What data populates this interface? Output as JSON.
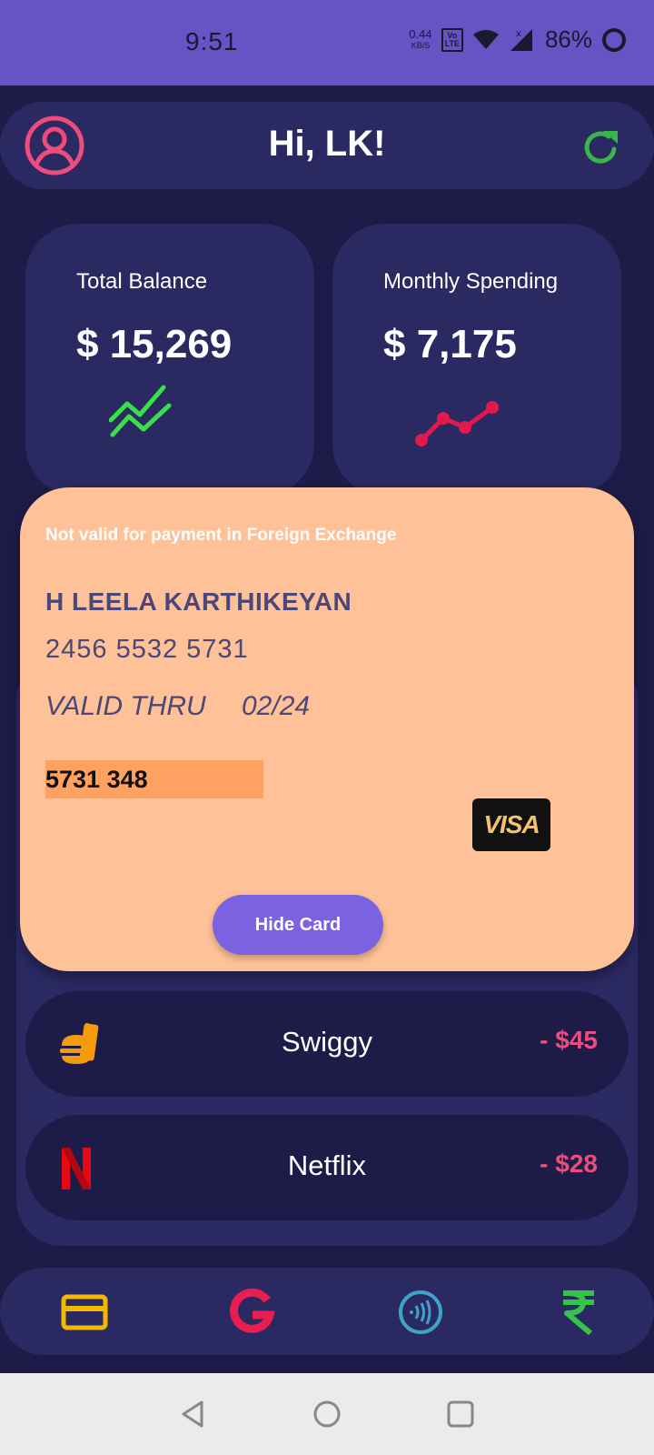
{
  "status_bar": {
    "time": "9:51",
    "net_speed_value": "0.44",
    "net_speed_unit": "KB/S",
    "volte_line1": "Vo",
    "volte_line2": "LTE",
    "battery_percent": "86%"
  },
  "header": {
    "greeting": "Hi, LK!",
    "avatar_icon": "user-circle-icon",
    "refresh_icon": "refresh-icon"
  },
  "stats": {
    "total_balance": {
      "label": "Total Balance",
      "value": "$ 15,269",
      "trend_icon": "trend-zigzag-icon",
      "color": "#39e04a"
    },
    "monthly_spending": {
      "label": "Monthly Spending",
      "value": "$ 7,175",
      "trend_icon": "trend-line-icon",
      "color": "#e0194f"
    }
  },
  "card": {
    "notice": "Not valid for payment in Foreign Exchange",
    "holder": "H LEELA KARTHIKEYAN",
    "number": "2456 5532 5731",
    "valid_label": "VALID THRU",
    "valid_date": "02/24",
    "cvv_strip": "5731 348",
    "network": "VISA",
    "hide_button": "Hide Card",
    "background": "#ffc197"
  },
  "transactions": [
    {
      "name": "Swiggy",
      "amount": "- $45",
      "icon": "food-bag-icon"
    },
    {
      "name": "Netflix",
      "amount": "- $28",
      "icon": "netflix-icon"
    }
  ],
  "bottom_nav": {
    "items": [
      {
        "icon": "credit-card-icon",
        "color": "#f5b800"
      },
      {
        "icon": "google-icon",
        "color": "#e81e4f"
      },
      {
        "icon": "contactless-icon",
        "color": "#3fa3c8"
      },
      {
        "icon": "rupee-icon",
        "color": "#35c44a"
      }
    ]
  }
}
